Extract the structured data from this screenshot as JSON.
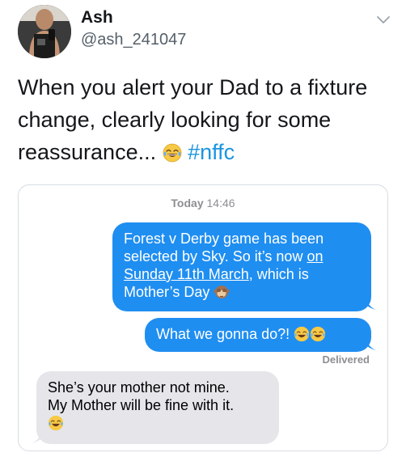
{
  "tweet": {
    "author": {
      "display_name": "Ash",
      "handle": "@ash_241047"
    },
    "text_lines": [
      "When you alert your Dad to a fixture",
      "change, clearly looking for some",
      "reassurance..."
    ],
    "hashtag": "#nffc",
    "menu_icon": "chevron-down-icon"
  },
  "imessage": {
    "timestamp_day": "Today",
    "timestamp_time": "14:46",
    "messages": [
      {
        "from": "me",
        "lines": [
          "Forest v Derby game has been",
          "selected by Sky. So it’s now ",
          "Sunday 11th March",
          ", which is",
          "Mother’s Day"
        ],
        "linked_text_1": "on",
        "emoji": "see-no-evil-monkey-icon"
      },
      {
        "from": "me",
        "text": "What we gonna do?!",
        "emoji": "tears-of-joy-icon"
      },
      {
        "from": "dad",
        "lines": [
          "She’s your mother not mine.",
          "My Mother will be fine with it."
        ],
        "emoji": "tears-of-joy-icon"
      }
    ],
    "delivered_label": "Delivered",
    "colors": {
      "sent_bubble": "#1f8ef1",
      "received_bubble": "#e5e5ea",
      "hashtag": "#1b95e0"
    }
  }
}
